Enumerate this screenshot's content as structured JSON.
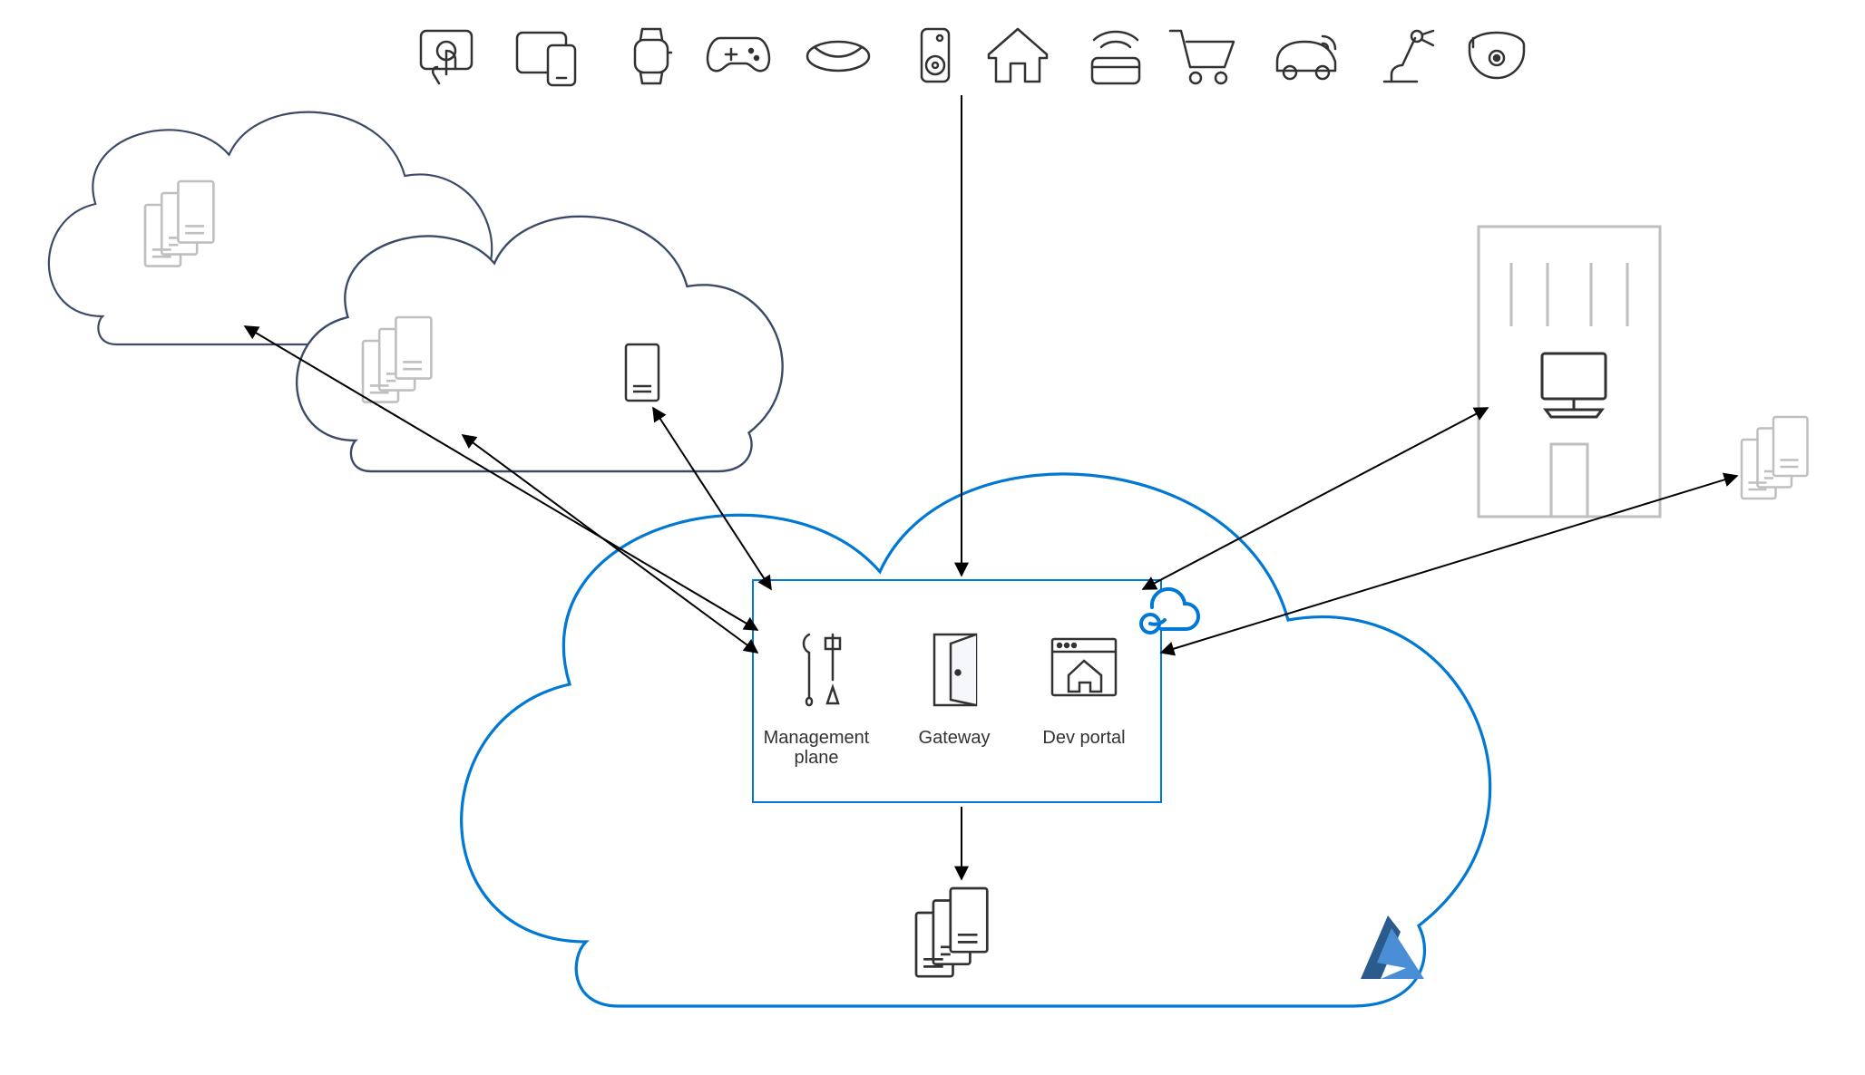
{
  "diagram": {
    "apim_box": {
      "mgmt_label": "Management\nplane",
      "gateway_label": "Gateway",
      "devportal_label": "Dev portal"
    },
    "colors": {
      "azure_blue": "#0078d4",
      "outline_dark": "#323232",
      "outline_light": "#bfbfbf",
      "cloud_navy": "#3b4a66"
    }
  }
}
